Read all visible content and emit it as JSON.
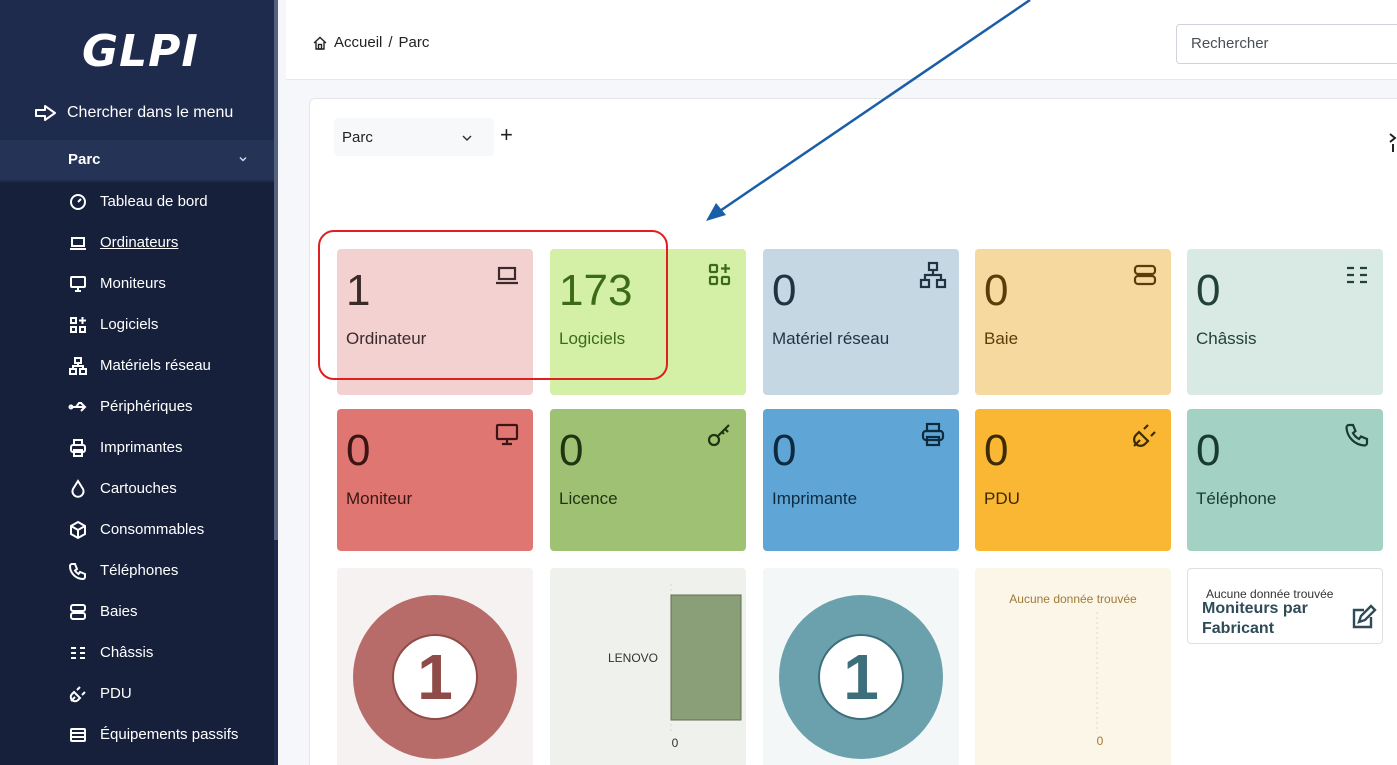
{
  "sidebar": {
    "logo": "GLPI",
    "menu_search": "Chercher dans le menu",
    "section": "Parc",
    "items": [
      {
        "label": "Tableau de bord",
        "icon": "dashboard-icon"
      },
      {
        "label": "Ordinateurs",
        "icon": "laptop-icon"
      },
      {
        "label": "Moniteurs",
        "icon": "monitor-icon"
      },
      {
        "label": "Logiciels",
        "icon": "apps-icon"
      },
      {
        "label": "Matériels réseau",
        "icon": "network-icon"
      },
      {
        "label": "Périphériques",
        "icon": "usb-icon"
      },
      {
        "label": "Imprimantes",
        "icon": "printer-icon"
      },
      {
        "label": "Cartouches",
        "icon": "droplet-icon"
      },
      {
        "label": "Consommables",
        "icon": "package-icon"
      },
      {
        "label": "Téléphones",
        "icon": "phone-icon"
      },
      {
        "label": "Baies",
        "icon": "server-icon"
      },
      {
        "label": "Châssis",
        "icon": "chassis-icon"
      },
      {
        "label": "PDU",
        "icon": "plug-icon"
      },
      {
        "label": "Équipements passifs",
        "icon": "passive-icon"
      }
    ]
  },
  "header": {
    "home": "Accueil",
    "separator": "/",
    "current": "Parc",
    "search_placeholder": "Rechercher"
  },
  "dashboard": {
    "selected": "Parc",
    "add": "+"
  },
  "cards_row1": [
    {
      "value": "1",
      "label": "Ordinateur",
      "bg": "#f3d1d1",
      "color": "#3a2a2a",
      "icon": "laptop-icon"
    },
    {
      "value": "173",
      "label": "Logiciels",
      "bg": "#d3f0a6",
      "color": "#3b6b16",
      "icon": "apps-icon"
    },
    {
      "value": "0",
      "label": "Matériel réseau",
      "bg": "#c6d7e4",
      "color": "#1f3342",
      "icon": "network-icon"
    },
    {
      "value": "0",
      "label": "Baie",
      "bg": "#f5d99e",
      "color": "#5b3d0b",
      "icon": "server-icon"
    },
    {
      "value": "0",
      "label": "Châssis",
      "bg": "#d8eae3",
      "color": "#22413a",
      "icon": "chassis-icon"
    }
  ],
  "cards_row2": [
    {
      "value": "0",
      "label": "Moniteur",
      "bg": "#e07672",
      "color": "#3a1514",
      "icon": "monitor-icon"
    },
    {
      "value": "0",
      "label": "Licence",
      "bg": "#9fc173",
      "color": "#1f3410",
      "icon": "key-icon"
    },
    {
      "value": "0",
      "label": "Imprimante",
      "bg": "#5fa6d6",
      "color": "#0e2a3f",
      "icon": "printer-icon"
    },
    {
      "value": "0",
      "label": "PDU",
      "bg": "#f9b733",
      "color": "#3d2a02",
      "icon": "plug-icon"
    },
    {
      "value": "0",
      "label": "Téléphone",
      "bg": "#a3d1c3",
      "color": "#183a31",
      "icon": "phone-icon"
    }
  ],
  "widgets_row3": {
    "donut1": {
      "value": "1",
      "color": "#b86c69"
    },
    "bar": {
      "category": "LENOVO",
      "value": 1,
      "tick": "0",
      "color": "#8a9f78"
    },
    "donut2": {
      "value": "1",
      "color": "#6aa1ad"
    },
    "empty": {
      "text": "Aucune donnée trouvée",
      "tick": "0"
    },
    "monitors": {
      "no_data": "Aucune donnée trouvée",
      "title": "Moniteurs par Fabricant"
    }
  }
}
